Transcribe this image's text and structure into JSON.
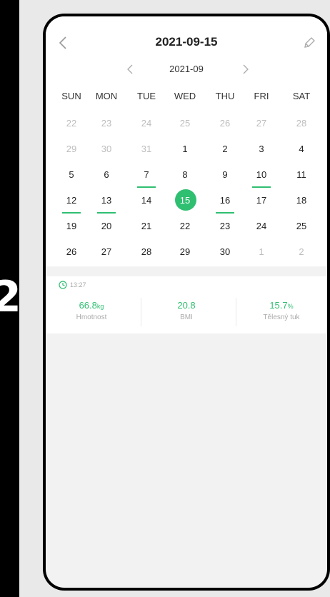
{
  "step": "2",
  "header": {
    "title": "2021-09-15"
  },
  "calendar": {
    "month_label": "2021-09",
    "weekdays": [
      "SUN",
      "MON",
      "TUE",
      "WED",
      "THU",
      "FRI",
      "SAT"
    ],
    "weeks": [
      [
        {
          "d": "22",
          "m": true
        },
        {
          "d": "23",
          "m": true
        },
        {
          "d": "24",
          "m": true
        },
        {
          "d": "25",
          "m": true
        },
        {
          "d": "26",
          "m": true
        },
        {
          "d": "27",
          "m": true
        },
        {
          "d": "28",
          "m": true
        }
      ],
      [
        {
          "d": "29",
          "m": true
        },
        {
          "d": "30",
          "m": true
        },
        {
          "d": "31",
          "m": true
        },
        {
          "d": "1"
        },
        {
          "d": "2"
        },
        {
          "d": "3"
        },
        {
          "d": "4"
        }
      ],
      [
        {
          "d": "5"
        },
        {
          "d": "6"
        },
        {
          "d": "7",
          "u": true
        },
        {
          "d": "8"
        },
        {
          "d": "9"
        },
        {
          "d": "10",
          "u": true
        },
        {
          "d": "11"
        }
      ],
      [
        {
          "d": "12",
          "u": true
        },
        {
          "d": "13",
          "u": true
        },
        {
          "d": "14"
        },
        {
          "d": "15",
          "s": true
        },
        {
          "d": "16",
          "u": true
        },
        {
          "d": "17"
        },
        {
          "d": "18"
        }
      ],
      [
        {
          "d": "19"
        },
        {
          "d": "20"
        },
        {
          "d": "21"
        },
        {
          "d": "22"
        },
        {
          "d": "23"
        },
        {
          "d": "24"
        },
        {
          "d": "25"
        }
      ],
      [
        {
          "d": "26"
        },
        {
          "d": "27"
        },
        {
          "d": "28"
        },
        {
          "d": "29"
        },
        {
          "d": "30"
        },
        {
          "d": "1",
          "m": true
        },
        {
          "d": "2",
          "m": true
        }
      ]
    ]
  },
  "record": {
    "time": "13:27",
    "metrics": [
      {
        "value": "66.8",
        "unit": "kg",
        "label": "Hmotnost"
      },
      {
        "value": "20.8",
        "unit": "",
        "label": "BMI"
      },
      {
        "value": "15.7",
        "unit": "%",
        "label": "Tělesný tuk"
      }
    ]
  },
  "colors": {
    "accent": "#2fbf71",
    "muted": "#bdbdbd"
  }
}
